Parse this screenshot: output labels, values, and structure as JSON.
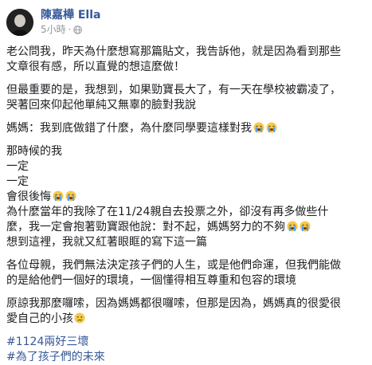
{
  "author": {
    "name": "陳嘉樺 Ella",
    "time": "5小時",
    "separator": "·"
  },
  "paragraphs": [
    [
      "老公問我，昨天為什麼想寫那篇貼文，我告訴他，就是因為看到那些",
      "文章很有感，所以直覺的想這麼做！"
    ],
    [
      "但最重要的是，我想到，如果勁寶長大了，有一天在學校被霸凌了，",
      "哭著回來仰起他單純又無辜的臉對我說"
    ],
    [
      "媽媽：我到底做錯了什麼，為什麼同學要這樣對我"
    ],
    [
      "那時候的我",
      "一定",
      "一定",
      "會很後悔",
      "為什麼當年的我除了在11/24親自去投票之外，卻沒有再多做些什",
      "麼，我一定會抱著勁寶跟他說：對不起，媽媽努力的不夠",
      "想到這裡，我就又紅著眼眶的寫下這一篇"
    ],
    [
      "各位母親，我們無法決定孩子們的人生，或是他們命運，但我們能做",
      "的是給他們一個好的環境，一個懂得相互尊重和包容的環境"
    ],
    [
      "原諒我那麼囉嗦，因為媽媽都很囉嗦，但那是因為，媽媽真的很愛很",
      "愛自己的小孩"
    ]
  ],
  "hashtags": [
    "#1124兩好三壞",
    "#為了孩子們的未來"
  ],
  "icons": {
    "globe": "globe-icon",
    "crying": "loudly-crying-face-emoji",
    "sad": "sad-tear-face-emoji"
  },
  "colors": {
    "link": "#365899",
    "text": "#1c1e21",
    "meta": "#90949c"
  }
}
